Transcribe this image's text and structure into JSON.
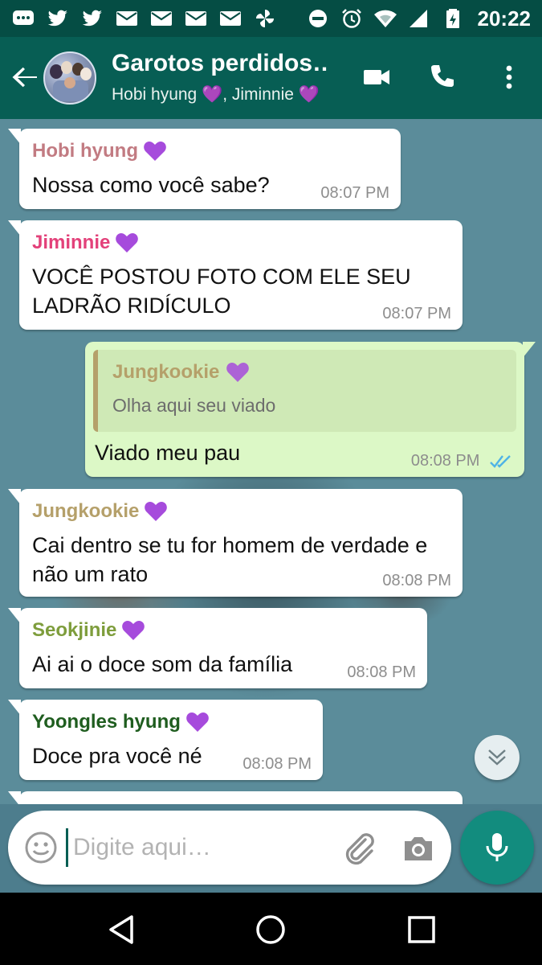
{
  "status_bar": {
    "time": "20:22",
    "left_icons": [
      "chat-bubble-icon",
      "twitter-icon",
      "twitter-icon",
      "mail-icon",
      "mail-icon",
      "mail-icon",
      "mail-icon",
      "pinwheel-icon"
    ],
    "right_icons": [
      "do-not-disturb-icon",
      "alarm-icon",
      "wifi-icon",
      "signal-icon",
      "battery-charging-icon"
    ]
  },
  "header": {
    "title": "Garotos perdidos…",
    "subtitle": "Hobi hyung 💜, Jiminnie 💜",
    "actions": [
      "video-call-icon",
      "phone-icon",
      "more-vert-icon"
    ]
  },
  "colors": {
    "header_bg": "#075e54",
    "status_bg": "#054d44",
    "accent": "#128c7e",
    "outgoing_bubble": "#dcf8c6",
    "heart": "#a64bdc"
  },
  "messages": [
    {
      "sender": "Hobi hyung",
      "sender_color": "#c27b82",
      "text": "Nossa como você sabe?",
      "time": "08:07 PM",
      "outgoing": false
    },
    {
      "sender": "Jiminnie",
      "sender_color": "#e3417a",
      "text": "VOCÊ POSTOU FOTO COM ELE SEU LADRÃO RIDÍCULO",
      "time": "08:07 PM",
      "outgoing": false
    },
    {
      "quoted_sender": "Jungkookie",
      "quoted_text": "Olha aqui seu viado",
      "text": "Viado meu pau",
      "time": "08:08 PM",
      "outgoing": true,
      "status": "read"
    },
    {
      "sender": "Jungkookie",
      "sender_color": "#b5a06a",
      "text": "Cai dentro se tu for homem de verdade e não um rato",
      "time": "08:08 PM",
      "outgoing": false
    },
    {
      "sender": "Seokjinie",
      "sender_color": "#7e9d3c",
      "text": "Ai ai o doce som da família",
      "time": "08:08 PM",
      "outgoing": false
    },
    {
      "sender": "Yoongles hyung",
      "sender_color": "#1f5d1f",
      "text": "Doce pra você né",
      "time": "08:08 PM",
      "outgoing": false
    }
  ],
  "composer": {
    "placeholder": "Digite aqui…",
    "value": ""
  },
  "nav": [
    "back-triangle-icon",
    "home-circle-icon",
    "recents-square-icon"
  ]
}
